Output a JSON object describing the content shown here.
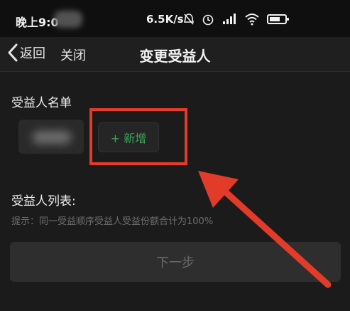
{
  "status_bar": {
    "time": "晚上9:0",
    "network_speed": "6.5K/s",
    "icons": [
      "mute-bell-icon",
      "alarm-icon",
      "cell-signal-icon",
      "wifi-icon",
      "battery-icon"
    ],
    "battery_level": 0.7
  },
  "nav": {
    "back_label": "返回",
    "close_label": "关闭",
    "title": "变更受益人"
  },
  "beneficiary_names": {
    "title": "受益人名单",
    "add_label": "+ 新增"
  },
  "beneficiary_list": {
    "title": "受益人列表:",
    "hint": "提示：同一受益顺序受益人受益份额合计为100%"
  },
  "next_label": "下一步",
  "colors": {
    "accent_green": "#3aa55a",
    "annotation_red": "#e33b2a",
    "background": "#1b1b1b"
  }
}
